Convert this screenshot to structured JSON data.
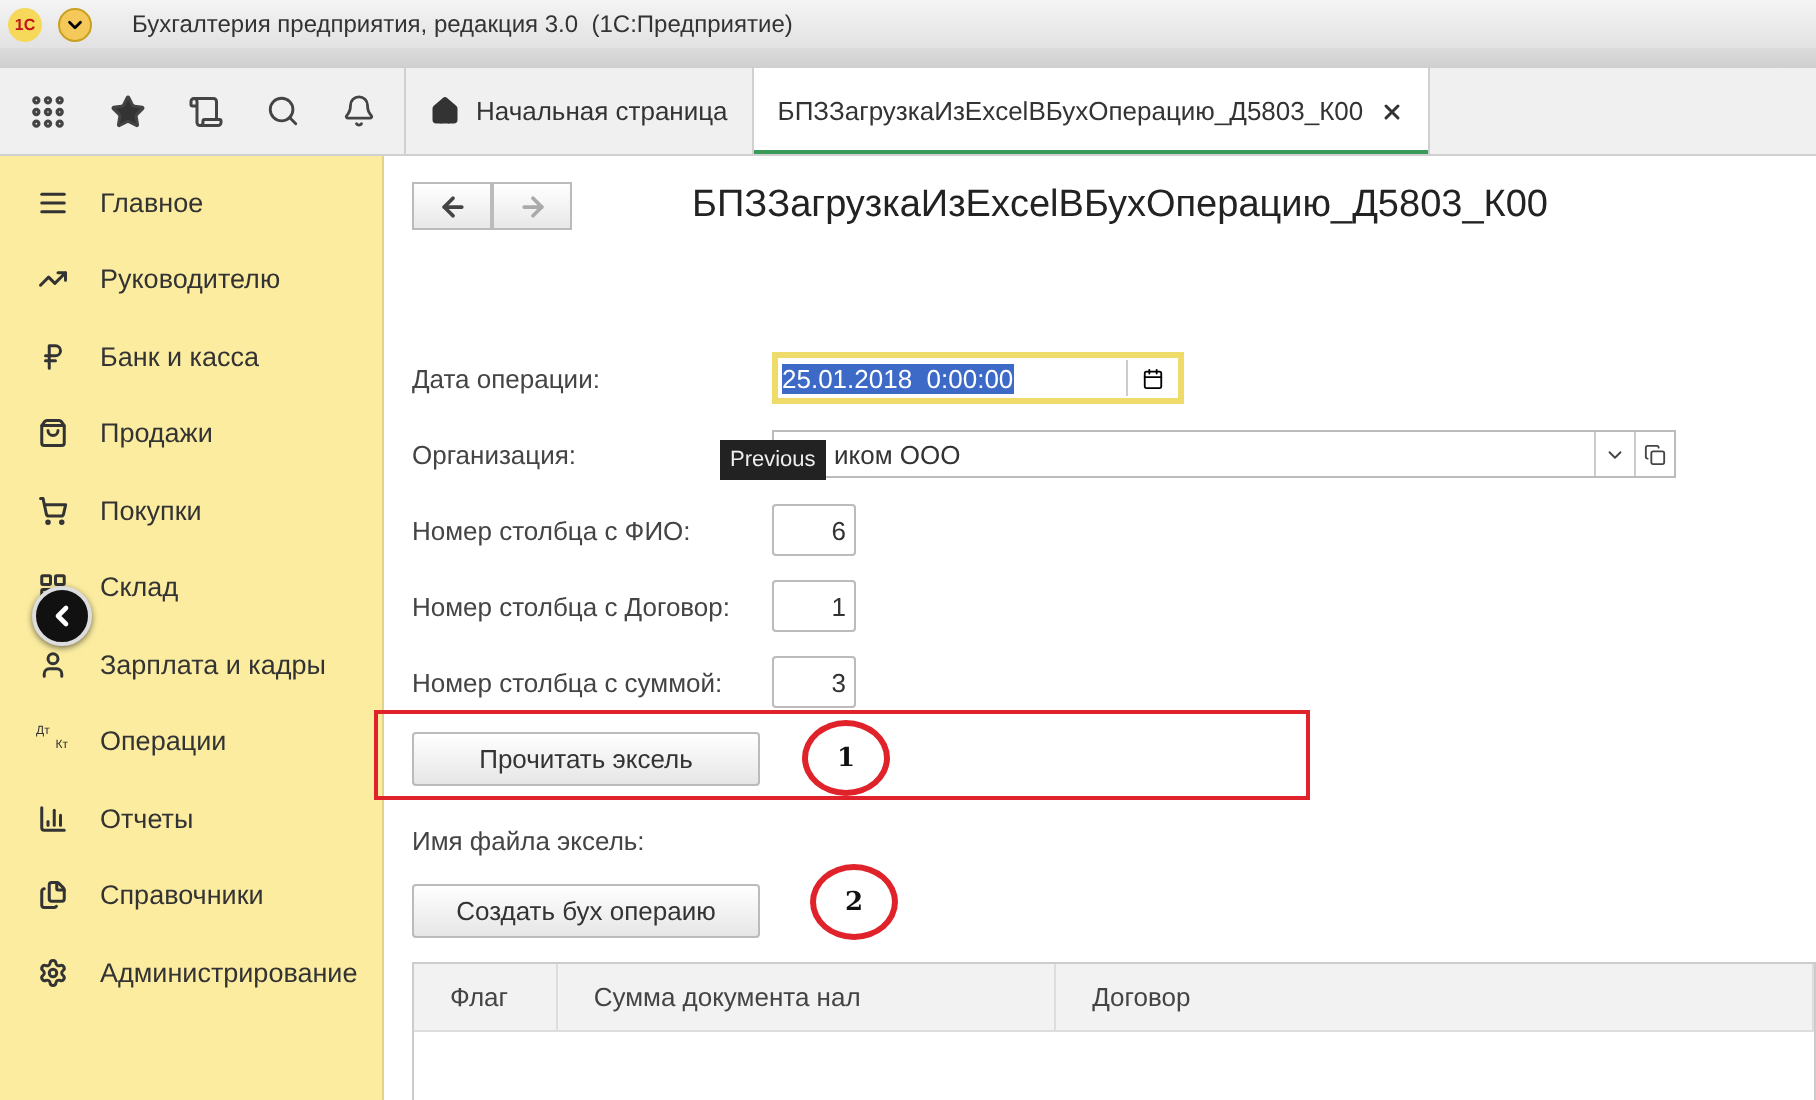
{
  "window": {
    "title": "Бухгалтерия предприятия, редакция 3.0  (1С:Предприятие)",
    "logo": "1С"
  },
  "tabs": [
    {
      "label": "Начальная страница",
      "selected": false
    },
    {
      "label": "БПЗЗагрузкаИзExcelВБухОперацию_Д5803_К00",
      "selected": true
    }
  ],
  "sidebar": {
    "items": [
      {
        "label": "Главное"
      },
      {
        "label": "Руководителю"
      },
      {
        "label": "Банк и касса"
      },
      {
        "label": "Продажи"
      },
      {
        "label": "Покупки"
      },
      {
        "label": "Склад"
      },
      {
        "label": "Зарплата и кадры"
      },
      {
        "label": "Операции",
        "icon_text": [
          "Дт",
          "Кт"
        ]
      },
      {
        "label": "Отчеты"
      },
      {
        "label": "Справочники"
      },
      {
        "label": "Администрирование"
      }
    ]
  },
  "form": {
    "title": "БПЗЗагрузкаИзExcelВБухОперацию_Д5803_К00",
    "fields": [
      {
        "label": "Дата операции:",
        "kind": "date",
        "value": "25.01.2018  0:00:00",
        "focused": true
      },
      {
        "label": "Организация:",
        "kind": "select",
        "value": "иком ООО",
        "focused": false
      },
      {
        "label": "Номер столбца с ФИО:",
        "kind": "number",
        "value": "6",
        "focused": false
      },
      {
        "label": "Номер столбца с Договор:",
        "kind": "number",
        "value": "1",
        "focused": false
      },
      {
        "label": "Номер столбца с суммой:",
        "kind": "number",
        "value": "3",
        "focused": false
      }
    ],
    "read_button": "Прочитать эксель",
    "file_label": "Имя файла эксель:",
    "create_button": "Создать бух операию",
    "table": {
      "columns": [
        "Флаг",
        "Сумма документа нал",
        "Договор"
      ]
    }
  },
  "tooltip": "Previous",
  "annotations": [
    {
      "label": "1"
    },
    {
      "label": "2"
    }
  ]
}
